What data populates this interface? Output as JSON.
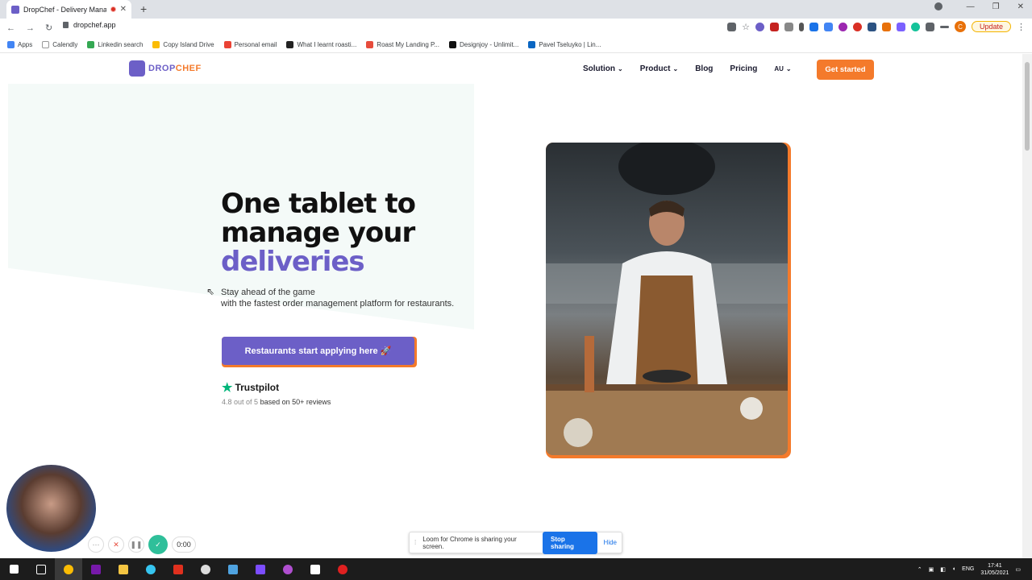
{
  "browser": {
    "tab_title": "DropChef - Delivery Manage",
    "url": "dropchef.app",
    "update_label": "Update",
    "profile_initial": "C"
  },
  "bookmarks": [
    {
      "label": "Apps",
      "color": "#4285f4"
    },
    {
      "label": "Calendly",
      "color": "#ffffff"
    },
    {
      "label": "Linkedin search",
      "color": "#34a853"
    },
    {
      "label": "Copy Island Drive",
      "color": "#fbbc04"
    },
    {
      "label": "Personal email",
      "color": "#ea4335"
    },
    {
      "label": "What I learnt roasti...",
      "color": "#222222"
    },
    {
      "label": "Roast My Landing P...",
      "color": "#e74c3c"
    },
    {
      "label": "Designjoy - Unlimit...",
      "color": "#111111"
    },
    {
      "label": "Pavel Tseluyko | Lin...",
      "color": "#0a66c2"
    }
  ],
  "site": {
    "logo_text_a": "DROP",
    "logo_text_b": "CHEF",
    "nav": [
      {
        "label": "Solution",
        "dropdown": true
      },
      {
        "label": "Product",
        "dropdown": true
      },
      {
        "label": "Blog",
        "dropdown": false
      },
      {
        "label": "Pricing",
        "dropdown": false
      },
      {
        "label": "AU",
        "dropdown": true
      }
    ],
    "cta_label": "Get started",
    "hero": {
      "line1": "One tablet to",
      "line2": "manage your",
      "line3": "deliveries",
      "sub1": "Stay ahead of the game",
      "sub2": "with the fastest order management platform for restaurants.",
      "button_label": "Restaurants start applying here 🚀"
    },
    "trustpilot": {
      "brand": "Trustpilot",
      "score_text": "4.8 out of 5",
      "reviews_text": "based on 50+ reviews"
    },
    "accent": "#6c5fc7",
    "orange": "#f47a2b"
  },
  "loom": {
    "timer": "0:00",
    "share_text": "Loom for Chrome is sharing your screen.",
    "stop_label": "Stop sharing",
    "hide_label": "Hide"
  },
  "taskbar": {
    "lang": "ENG",
    "time": "17:41",
    "date": "31/05/2021"
  }
}
